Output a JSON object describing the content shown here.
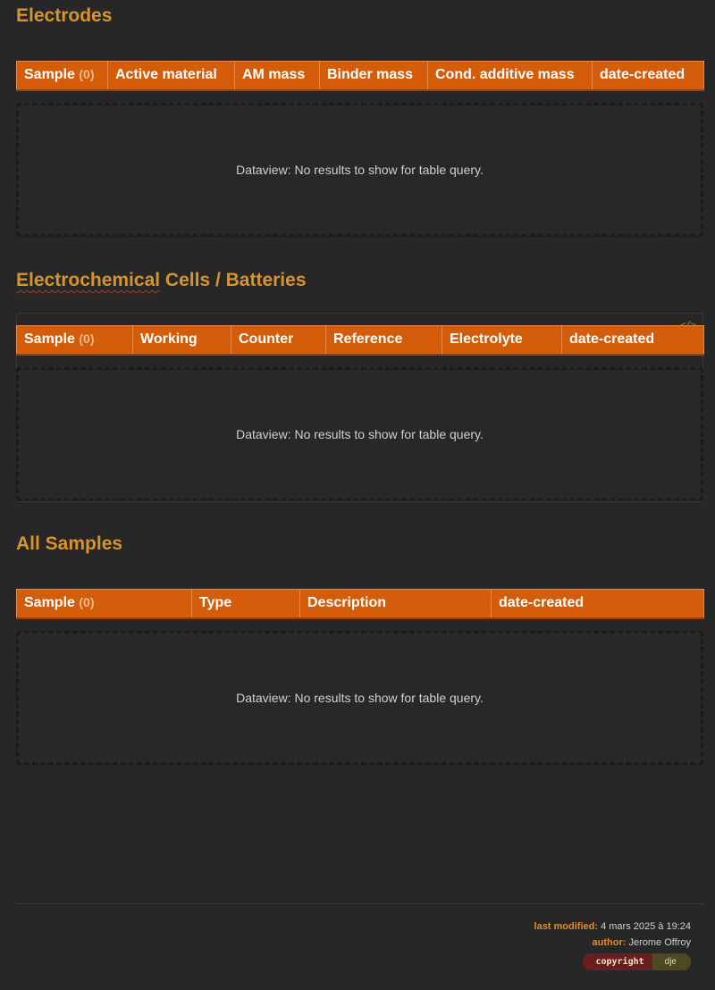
{
  "sections": [
    {
      "title": "Electrodes",
      "columns": [
        "Sample",
        "Active material",
        "AM mass",
        "Binder mass",
        "Cond. additive mass",
        "date-created"
      ],
      "count": "(0)",
      "empty_message": "Dataview: No results to show for table query."
    },
    {
      "title_misspelled": "Electrochemical",
      "title_rest": " Cells / Batteries",
      "columns": [
        "Sample",
        "Working",
        "Counter",
        "Reference",
        "Electrolyte",
        "date-created"
      ],
      "count": "(0)",
      "code_icon": "</>",
      "empty_message": "Dataview: No results to show for table query."
    },
    {
      "title": "All Samples",
      "columns": [
        "Sample",
        "Type",
        "Description",
        "date-created"
      ],
      "count": "(0)",
      "empty_message": "Dataview: No results to show for table query."
    }
  ],
  "footer": {
    "last_modified_label": "last modified:",
    "last_modified_value": "4 mars 2025 à 19:24",
    "author_label": "author:",
    "author_value": "Jerome Offroy",
    "badge_left": "copyright",
    "badge_right": "dje"
  },
  "colors": {
    "background": "#272727",
    "heading": "#d7942a",
    "table_header": "#d35d0b"
  }
}
